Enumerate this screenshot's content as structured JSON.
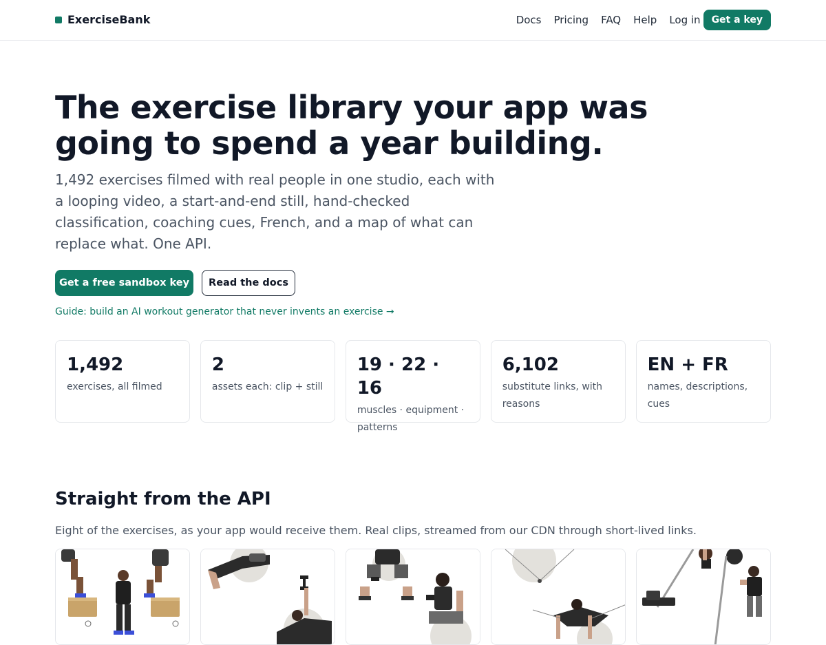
{
  "brand": {
    "name": "ExerciseBank",
    "accent": "#117a65"
  },
  "nav": {
    "items": [
      "Docs",
      "Pricing",
      "FAQ",
      "Help",
      "Log in"
    ],
    "cta": "Get a key"
  },
  "hero": {
    "title": "The exercise library your app was going to spend a year building.",
    "subtitle": "1,492 exercises filmed with real people in one studio, each with a looping video, a start-and-end still, hand-checked classification, coaching cues, French, and a map of what can replace what. One API.",
    "primary_button": "Get a free sandbox key",
    "secondary_button": "Read the docs",
    "guide_link": "Guide: build an AI workout generator that never invents an exercise →"
  },
  "stats": [
    {
      "value": "1,492",
      "label": "exercises, all filmed"
    },
    {
      "value": "2",
      "label": "assets each: clip + still"
    },
    {
      "value": "19 · 22 · 16",
      "label": "muscles · equipment · patterns"
    },
    {
      "value": "6,102",
      "label": "substitute links, with reasons"
    },
    {
      "value": "EN + FR",
      "label": "names, descriptions, cues"
    }
  ],
  "api_section": {
    "title": "Straight from the API",
    "subtitle": "Eight of the exercises, as your app would receive them. Real clips, streamed from our CDN through short-lived links."
  },
  "cards": [
    {
      "icon": "step-up-exercise-image"
    },
    {
      "icon": "stability-ball-dumbbell-press-image"
    },
    {
      "icon": "stability-ball-dumbbell-curl-image"
    },
    {
      "icon": "cable-fly-exercise-image"
    },
    {
      "icon": "landmine-barbell-exercise-image"
    }
  ]
}
